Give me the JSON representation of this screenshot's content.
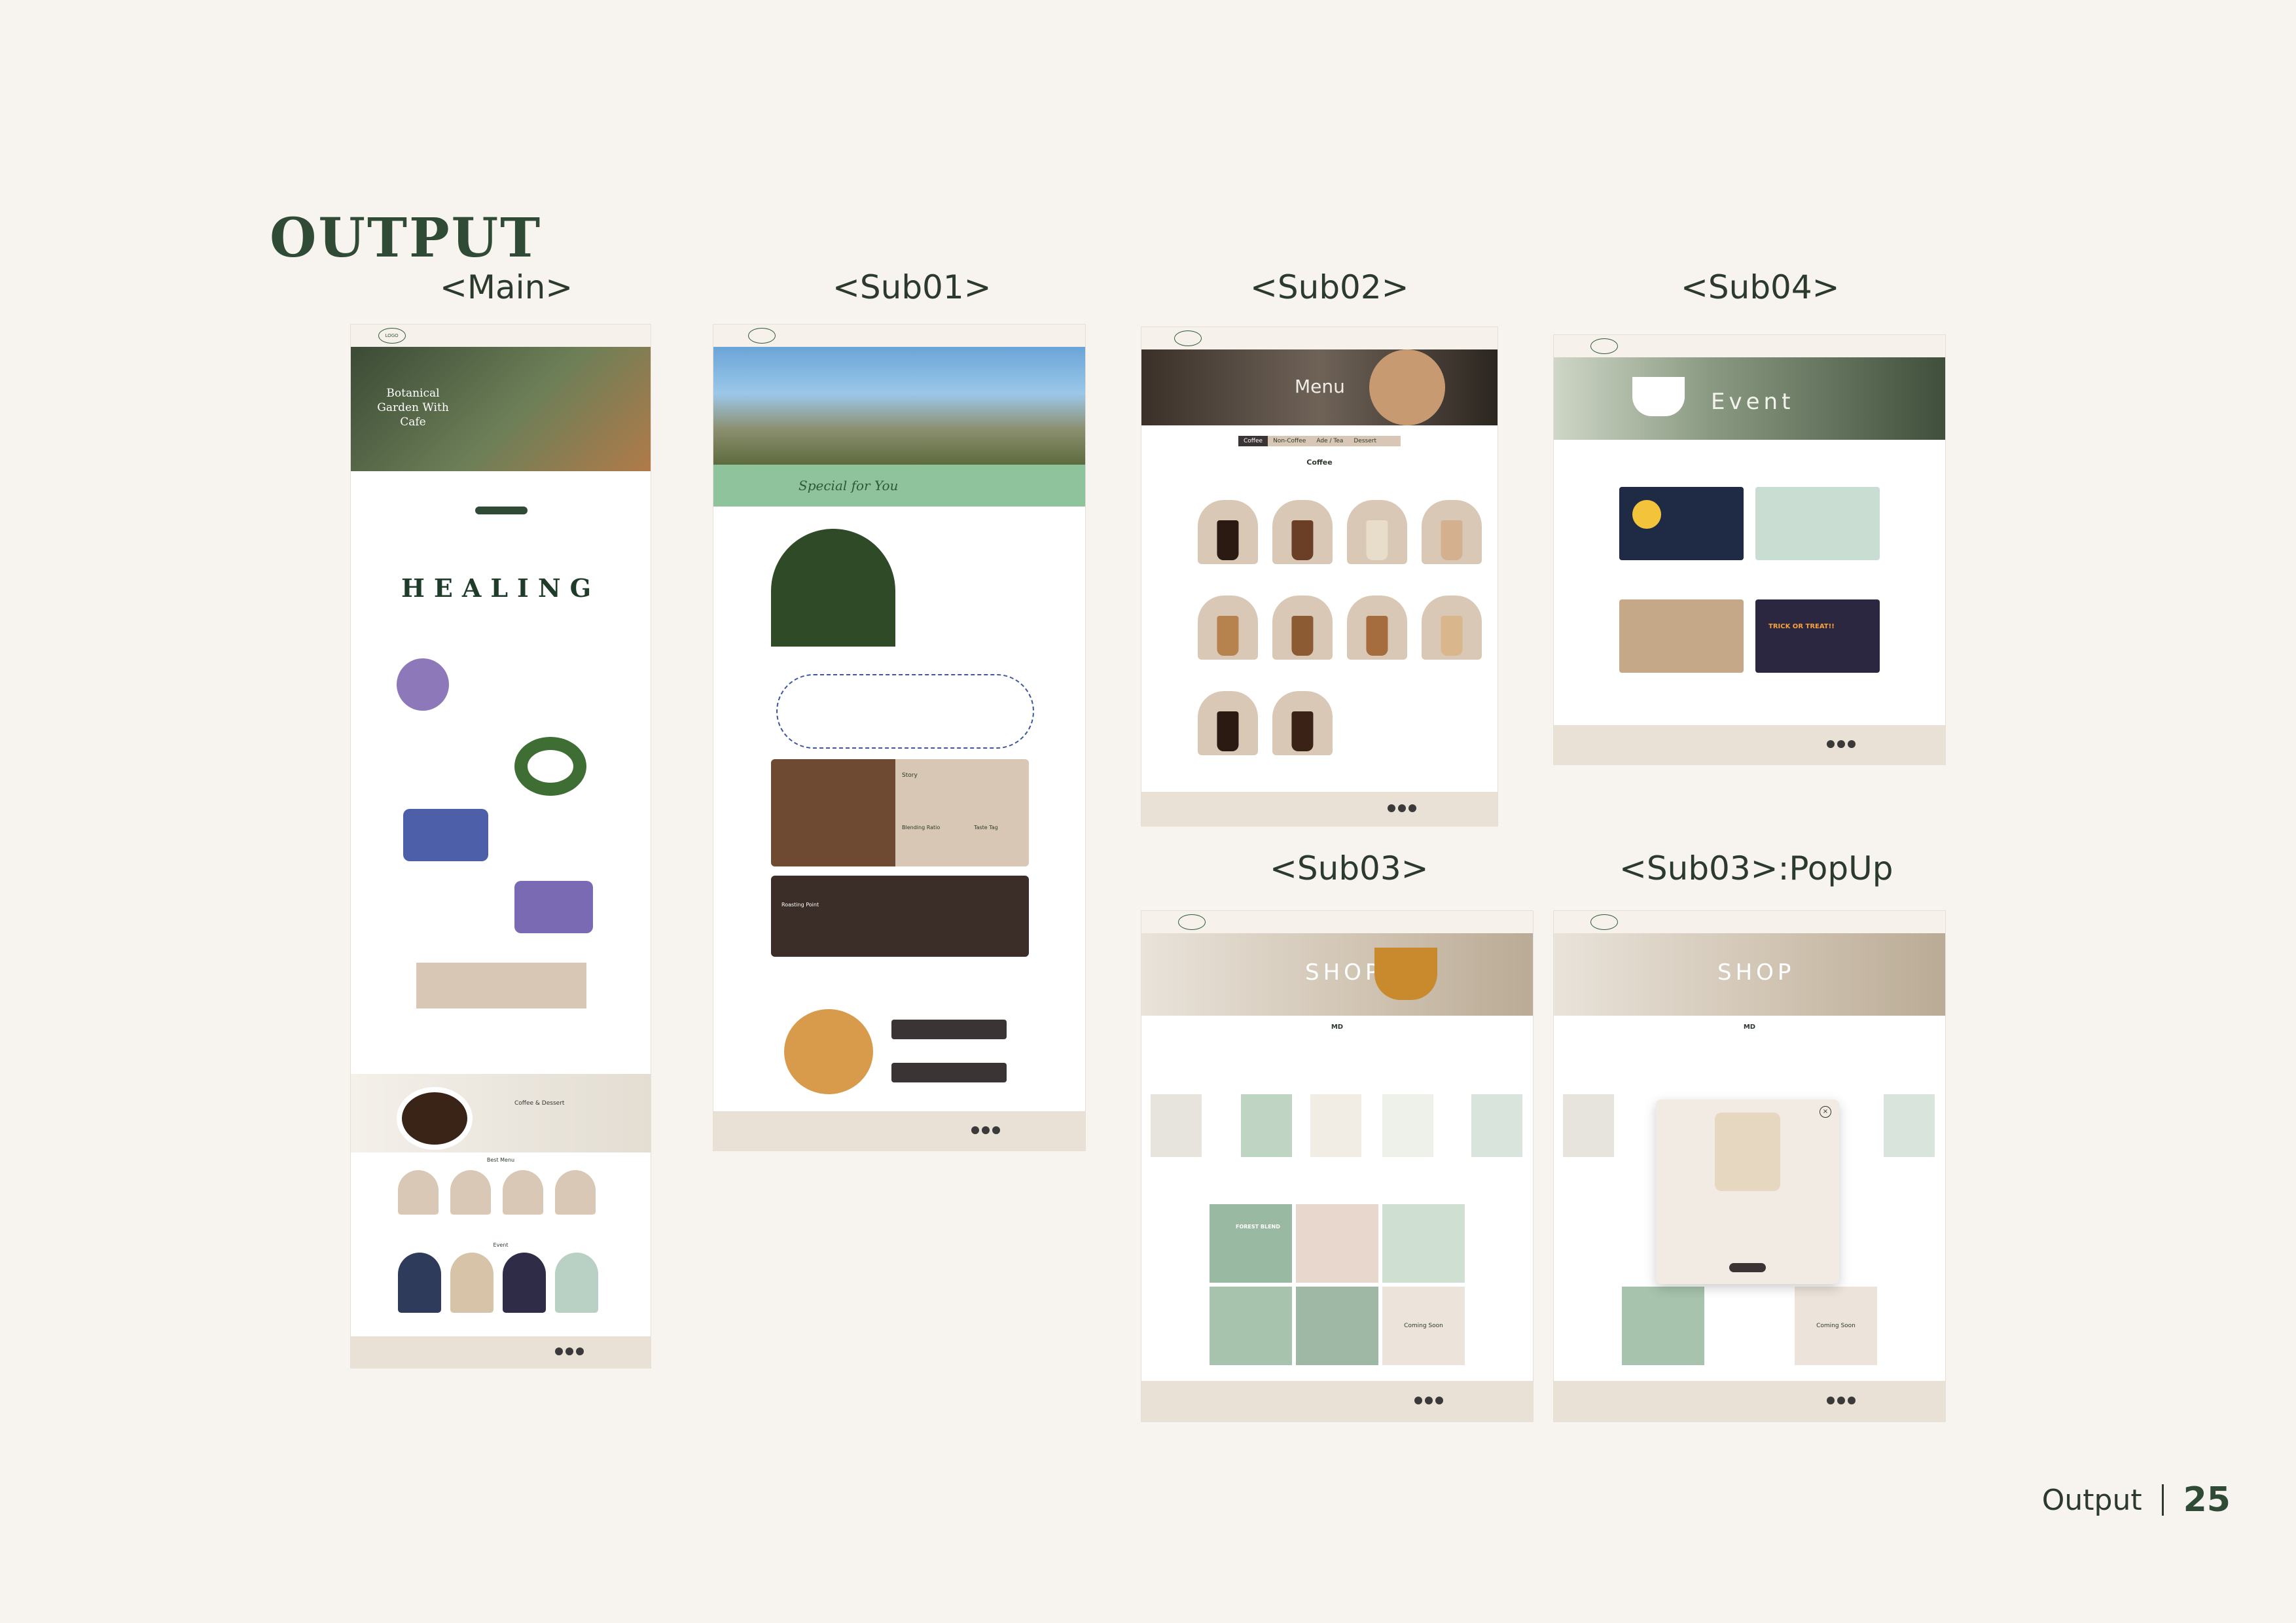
{
  "page": {
    "title": "OUTPUT",
    "footer_label": "Output",
    "page_number": "25"
  },
  "panels": {
    "main": {
      "label": "<Main>",
      "hero_title": "Botanical Garden With Cafe",
      "healing": "HEALING",
      "coffee_title": "Coffee & Dessert",
      "best_menu": "Best Menu",
      "event": "Event"
    },
    "sub01": {
      "label": "<Sub01>",
      "slogan": "Special for You",
      "story": "Story",
      "blending": "Blending Ratio",
      "taste": "Taste Tag",
      "roasting": "Roasting Point"
    },
    "sub02": {
      "label": "<Sub02>",
      "hero_title": "Menu",
      "tabs": [
        "Coffee",
        "Non-Coffee",
        "Ade / Tea",
        "Dessert"
      ],
      "section_title": "Coffee"
    },
    "sub04": {
      "label": "<Sub04>",
      "hero_title": "Event",
      "event_badge": "TRICK OR TREAT!!"
    },
    "sub03": {
      "label": "<Sub03>",
      "hero_title": "SHOP",
      "section_md": "MD",
      "coming_soon": "Coming Soon",
      "product_text": "FOREST BLEND"
    },
    "sub03_popup": {
      "label": "<Sub03>:PopUp",
      "hero_title": "SHOP",
      "section_md": "MD",
      "coming_soon": "Coming Soon"
    }
  },
  "colors": {
    "background": "#f7f3ee",
    "accent_green": "#2f4a35",
    "beige": "#d9c8b5",
    "mint": "#8fc39c"
  }
}
